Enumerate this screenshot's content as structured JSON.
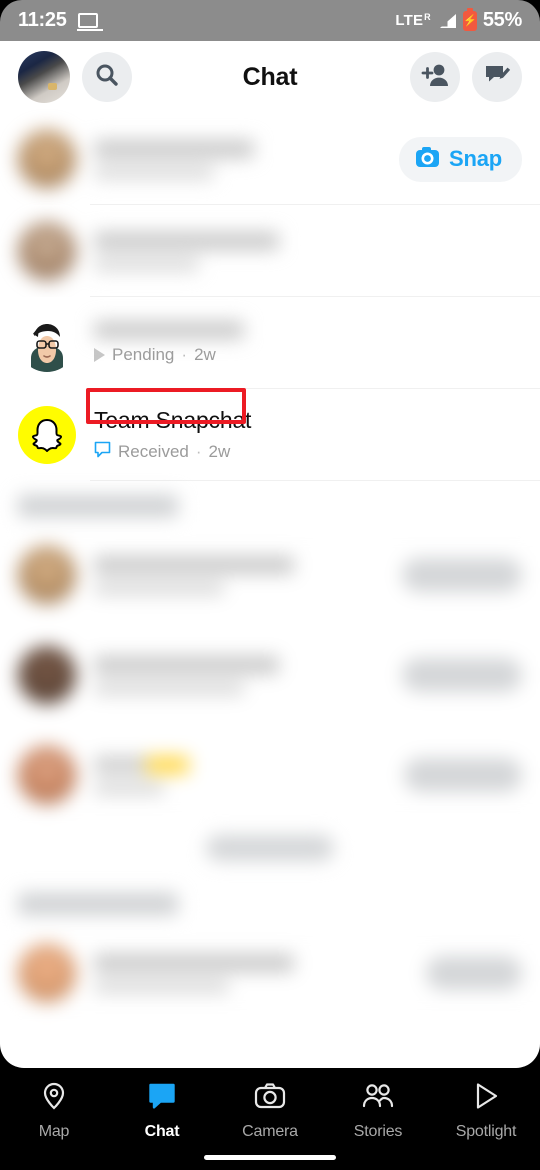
{
  "status_bar": {
    "time": "11:25",
    "cast_icon": "laptop-screen-icon",
    "network": "LTE",
    "roaming": "R",
    "signal_icon": "signal-bars-icon",
    "battery_icon": "battery-charging-icon",
    "battery_pct": "55%",
    "battery_color": "#f2593f",
    "bar_color": "#8c8c8c"
  },
  "header": {
    "title": "Chat",
    "avatar": "profile-avatar",
    "search_icon": "search-icon",
    "add_friend_icon": "add-friend-icon",
    "new_chat_icon": "new-chat-icon"
  },
  "chat_list": [
    {
      "id": "row-blurred-1",
      "name": "",
      "status": "",
      "blurred": true,
      "action": {
        "label": "Snap",
        "icon": "camera-icon",
        "color": "#1ba5f5"
      }
    },
    {
      "id": "row-blurred-2",
      "name": "",
      "status": "",
      "blurred": true
    },
    {
      "id": "row-pending",
      "name": "",
      "status_icon": "sent-arrow-icon",
      "status": "Pending",
      "separator": "·",
      "time": "2w",
      "highlighted": true,
      "highlight_color": "#ec1b24",
      "avatar": "bitmoji-avatar"
    },
    {
      "id": "row-team-snapchat",
      "name": "Team Snapchat",
      "status_icon": "received-chat-icon",
      "status": "Received",
      "separator": "·",
      "time": "2w",
      "avatar": "snapchat-ghost-logo",
      "avatar_color": "#fffc00"
    }
  ],
  "sections": [
    {
      "id": "section-quick-add",
      "header": "",
      "blurred": true,
      "rows": [
        {
          "id": "suggestion-1",
          "name": "",
          "sub": "",
          "button": ""
        },
        {
          "id": "suggestion-2",
          "name": "",
          "sub": "",
          "button": ""
        },
        {
          "id": "suggestion-3",
          "name": "",
          "sub": "",
          "button": ""
        }
      ],
      "see_more": ""
    },
    {
      "id": "section-recent",
      "header": "",
      "blurred": true,
      "rows": [
        {
          "id": "recent-1",
          "name": "",
          "sub": "",
          "button": ""
        }
      ]
    }
  ],
  "bottom_nav": {
    "items": [
      {
        "id": "nav-map",
        "label": "Map",
        "icon": "map-pin-icon",
        "active": false
      },
      {
        "id": "nav-chat",
        "label": "Chat",
        "icon": "chat-bubble-icon",
        "active": true
      },
      {
        "id": "nav-camera",
        "label": "Camera",
        "icon": "camera-icon",
        "active": false
      },
      {
        "id": "nav-stories",
        "label": "Stories",
        "icon": "people-icon",
        "active": false
      },
      {
        "id": "nav-spotlight",
        "label": "Spotlight",
        "icon": "play-icon",
        "active": false
      }
    ],
    "active_color": "#1ba5f5",
    "home_indicator": "home-indicator"
  }
}
